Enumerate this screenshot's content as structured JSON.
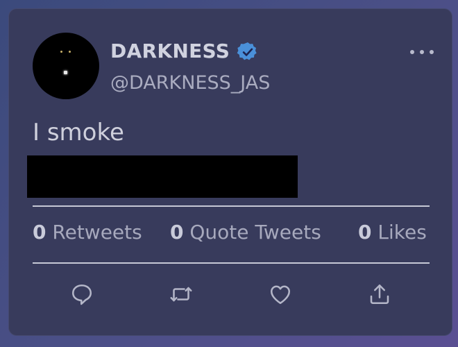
{
  "tweet": {
    "display_name": "DARKNESS",
    "handle": "@DARKNESS_JAS",
    "verified": true,
    "text": "I smoke",
    "text_redacted": true
  },
  "stats": {
    "retweets_count": "0",
    "retweets_label": "Retweets",
    "quote_tweets_count": "0",
    "quote_tweets_label": "Quote Tweets",
    "likes_count": "0",
    "likes_label": "Likes"
  },
  "actions": [
    {
      "name": "reply",
      "icon": "speech-bubble-icon"
    },
    {
      "name": "retweet",
      "icon": "retweet-arrows-icon"
    },
    {
      "name": "like",
      "icon": "heart-icon"
    },
    {
      "name": "share",
      "icon": "share-upload-icon"
    }
  ],
  "colors": {
    "card_background": "#383b5c",
    "verified_badge": "#4a90d9",
    "text_primary": "#cfd0dc",
    "text_secondary": "#a7a9bd"
  }
}
